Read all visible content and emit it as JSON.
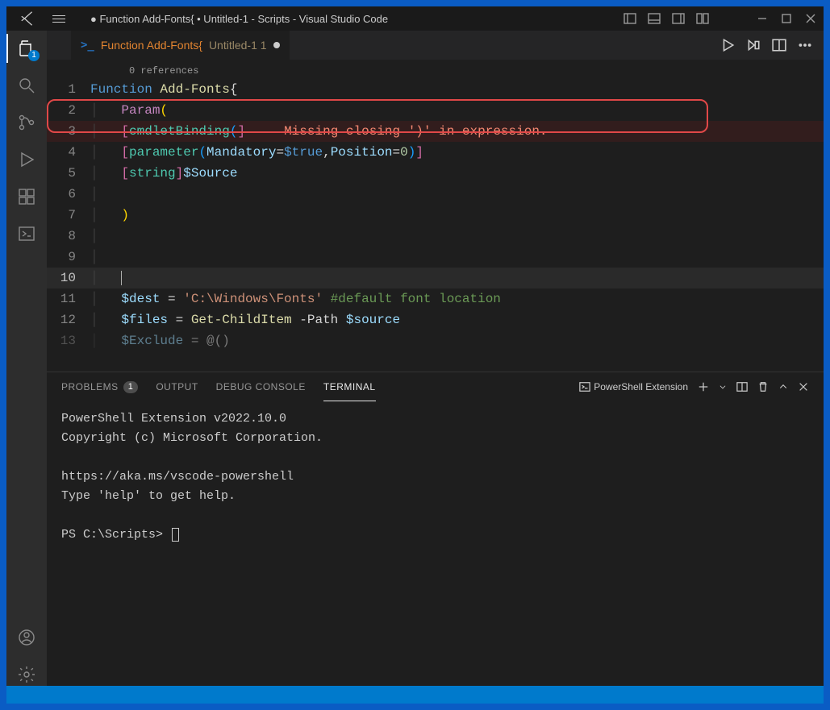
{
  "titleBar": {
    "title": "● Function Add-Fonts{ • Untitled-1 - Scripts - Visual Studio Code"
  },
  "activityBar": {
    "explorerBadge": "1"
  },
  "tab": {
    "psIcon": ">_",
    "name": "Function Add-Fonts{",
    "untitled": "Untitled-1 1"
  },
  "codelens": "0 references",
  "lines": {
    "l1": {
      "num": "1",
      "function": "Function",
      "name": "Add-Fonts",
      "brace": "{"
    },
    "l2": {
      "num": "2",
      "param": "Param",
      "paren": "("
    },
    "l3": {
      "num": "3",
      "open": "[",
      "binding": "cmdletBinding",
      "paren": "(",
      "close": "]",
      "error": "Missing closing ')' in expression."
    },
    "l4": {
      "num": "4",
      "open": "[",
      "attr": "parameter",
      "po": "(",
      "p1": "Mandatory",
      "eq1": "=",
      "v1": "$true",
      "comma": ",",
      "p2": "Position",
      "eq2": "=",
      "v2": "0",
      "pc": ")",
      "close": "]"
    },
    "l5": {
      "num": "5",
      "open": "[",
      "type": "string",
      "close": "]",
      "var": "$Source"
    },
    "l6": {
      "num": "6"
    },
    "l7": {
      "num": "7",
      "paren": ")"
    },
    "l8": {
      "num": "8"
    },
    "l9": {
      "num": "9"
    },
    "l10": {
      "num": "10"
    },
    "l11": {
      "num": "11",
      "var": "$dest",
      "eq": " = ",
      "str": "'C:\\Windows\\Fonts'",
      "comment": " #default font location"
    },
    "l12": {
      "num": "12",
      "var": "$files",
      "eq": " = ",
      "cmd": "Get-ChildItem",
      "flag": " -Path ",
      "arg": "$source"
    },
    "l13": {
      "num": "13",
      "var": "$Exclude",
      "eq": " = ",
      "rest": "@()"
    }
  },
  "panel": {
    "problems": "PROBLEMS",
    "problemsCount": "1",
    "output": "OUTPUT",
    "debug": "DEBUG CONSOLE",
    "terminal": "TERMINAL",
    "shellLabel": "PowerShell Extension"
  },
  "terminal": {
    "line1": "PowerShell Extension v2022.10.0",
    "line2": "Copyright (c) Microsoft Corporation.",
    "line3": "https://aka.ms/vscode-powershell",
    "line4": "Type 'help' to get help.",
    "prompt": "PS C:\\Scripts> "
  }
}
